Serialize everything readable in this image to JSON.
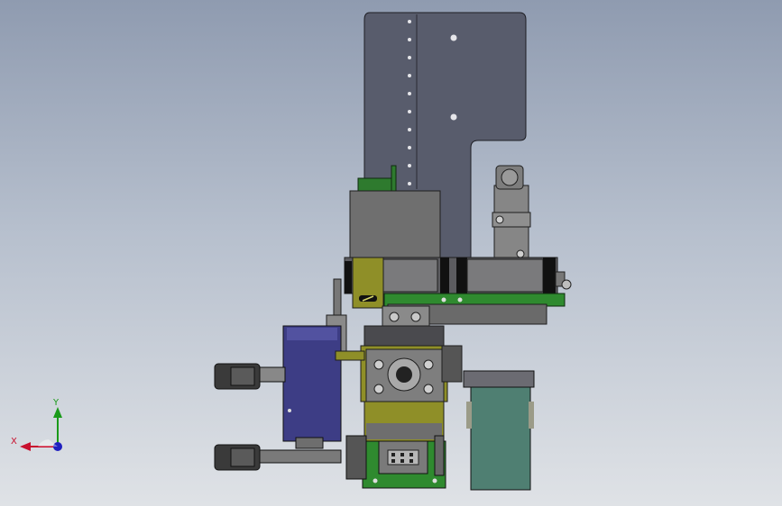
{
  "viewport": {
    "background_top": "#8f9bb0",
    "background_bottom": "#dfe2e6"
  },
  "triad": {
    "x_label": "X",
    "y_label": "Y",
    "x_color": "#c8102e",
    "y_color": "#1a9a1a",
    "z_color": "#1f1fbf"
  },
  "model": {
    "plate_color": "#5a5e6e",
    "green_color": "#2d8a2d",
    "olive_color": "#9a9a2e",
    "navy_color": "#3e3e8a",
    "teal_color": "#4f7f72"
  }
}
